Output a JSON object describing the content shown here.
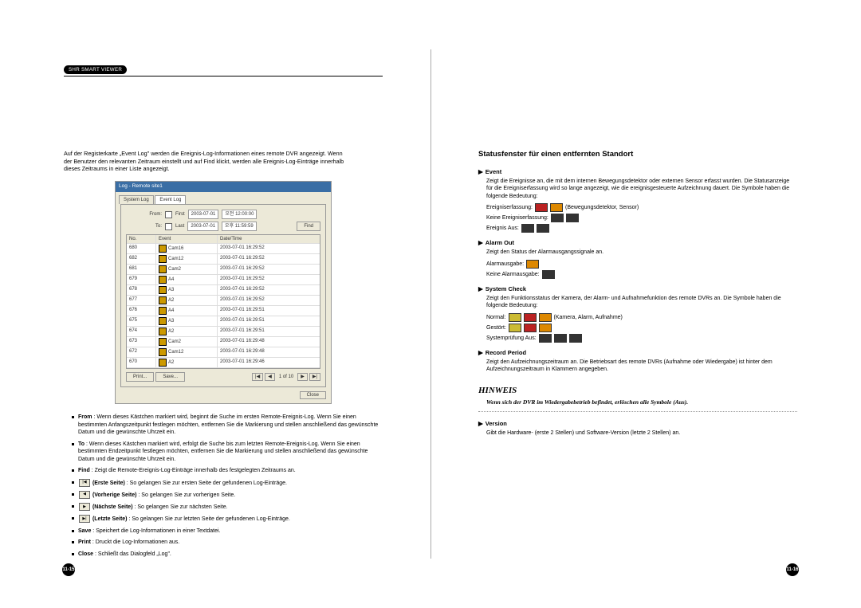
{
  "header": {
    "badge": "SHR SMART VIEWER"
  },
  "left": {
    "intro": "Auf der Registerkarte „Event Log\" werden die Ereignis-Log-Informationen eines remote DVR angezeigt. Wenn der Benutzer den relevanten Zeitraum einstellt und auf Find klickt, werden alle Ereignis-Log-Einträge innerhalb dieses Zeitraums in einer Liste angezeigt.",
    "dialog": {
      "title": "Log - Remote site1",
      "tabs": [
        "System Log",
        "Event Log"
      ],
      "from_label": "From:",
      "to_label": "To:",
      "first_ck": "First",
      "last_ck": "Last",
      "date1": "2003-07-01",
      "time1": "오전 12:00:00",
      "date2": "2003-07-01",
      "time2": "오후 11:59:59",
      "find": "Find",
      "print": "Print...",
      "save": "Save...",
      "close": "Close",
      "page_of": "1 of 10",
      "cols": {
        "no": "No.",
        "event": "Event",
        "dt": "Date/Time"
      },
      "rows": [
        {
          "no": "680",
          "ev": "Cam16",
          "dt": "2003-07-01 16:29:52"
        },
        {
          "no": "682",
          "ev": "Cam12",
          "dt": "2003-07-01 16:29:52"
        },
        {
          "no": "681",
          "ev": "Cam2",
          "dt": "2003-07-01 16:29:52"
        },
        {
          "no": "679",
          "ev": "A4",
          "dt": "2003-07-01 16:29:52"
        },
        {
          "no": "678",
          "ev": "A3",
          "dt": "2003-07-01 16:29:52"
        },
        {
          "no": "677",
          "ev": "A2",
          "dt": "2003-07-01 16:29:52"
        },
        {
          "no": "676",
          "ev": "A4",
          "dt": "2003-07-01 16:29:51"
        },
        {
          "no": "675",
          "ev": "A3",
          "dt": "2003-07-01 16:29:51"
        },
        {
          "no": "674",
          "ev": "A2",
          "dt": "2003-07-01 16:29:51"
        },
        {
          "no": "673",
          "ev": "Cam2",
          "dt": "2003-07-01 16:29:48"
        },
        {
          "no": "672",
          "ev": "Cam12",
          "dt": "2003-07-01 16:29:48"
        },
        {
          "no": "670",
          "ev": "A2",
          "dt": "2003-07-01 16:29:46"
        }
      ]
    },
    "bullets": [
      {
        "term": "From",
        "text": " : Wenn dieses Kästchen markiert wird, beginnt die Suche im ersten Remote-Ereignis-Log. Wenn Sie einen bestimmten Anfangszeitpunkt festlegen möchten, entfernen Sie die Markierung und stellen anschließend das gewünschte Datum und die gewünschte Uhrzeit ein."
      },
      {
        "term": "To",
        "text": " : Wenn dieses Kästchen markiert wird, erfolgt die Suche bis zum letzten Remote-Ereignis-Log. Wenn Sie einen bestimmten Endzeitpunkt festlegen möchten, entfernen Sie die Markierung und stellen anschließend das gewünschte Datum und die gewünschte Uhrzeit ein."
      },
      {
        "term": "Find",
        "text": " : Zeigt die Remote-Ereignis-Log-Einträge innerhalb des festgelegten Zeitraums an."
      },
      {
        "icon": "|◀",
        "term": "(Erste Seite)",
        "text": " : So gelangen Sie zur ersten Seite der gefundenen Log-Einträge."
      },
      {
        "icon": "◀",
        "term": "(Vorherige Seite)",
        "text": " : So gelangen Sie zur vorherigen Seite."
      },
      {
        "icon": "▶",
        "term": "(Nächste Seite)",
        "text": " : So gelangen Sie zur nächsten Seite."
      },
      {
        "icon": "▶|",
        "term": "(Letzte Seite)",
        "text": " : So gelangen Sie zur letzten Seite der gefundenen Log-Einträge."
      },
      {
        "term": "Save",
        "text": " : Speichert die Log-Informationen in einer Textdatei."
      },
      {
        "term": "Print",
        "text": " : Druckt die Log-Informationen aus."
      },
      {
        "term": "Close",
        "text": " : Schließt das Dialogfeld „Log\"."
      }
    ],
    "page_num": "11-15"
  },
  "right": {
    "title": "Statusfenster für einen entfernten Standort",
    "event": {
      "label": "Event",
      "desc": "Zeigt die Ereignisse an, die mit dem internen Bewegungsdetektor oder externen Sensor erfasst wurden. Die Statusanzeige für die Ereigniserfassung wird so lange angezeigt, wie die ereignisgesteuerte Aufzeichnung dauert. Die Symbole haben die folgende Bedeutung:",
      "l1a": "Ereigniserfassung:",
      "l1b": "(Bewegungsdetektor, Sensor)",
      "l2": "Keine Ereigniserfassung:",
      "l3": "Ereignis Aus:"
    },
    "alarm": {
      "label": "Alarm Out",
      "desc": "Zeigt den Status der Alarmausgangssignale an.",
      "l1": "Alarmausgabe:",
      "l2": "Keine Alarmausgabe:"
    },
    "syscheck": {
      "label": "System Check",
      "desc": "Zeigt den Funktionsstatus der Kamera, der Alarm- und Aufnahmefunktion des remote DVRs an. Die Symbole haben die folgende Bedeutung:",
      "l1a": "Normal:",
      "l1b": "(Kamera, Alarm, Aufnahme)",
      "l2": "Gestört:",
      "l3": "Systemprüfung Aus:"
    },
    "record": {
      "label": "Record Period",
      "desc": "Zeigt den Aufzeichnungszeitraum an.  Die Betriebsart des remote DVRs (Aufnahme oder Wiedergabe) ist hinter dem Aufzeichnungszeitraum in Klammern angegeben."
    },
    "hinweis_label": "HINWEIS",
    "hinweis_text": "Wenn sich der DVR im Wiedergabebetrieb befindet, erlöschen alle Symbole (Aus).",
    "version": {
      "label": "Version",
      "desc": "Gibt die Hardware- (erste 2 Stellen) und Software-Version (letzte 2 Stellen) an."
    },
    "page_num": "11-16"
  }
}
